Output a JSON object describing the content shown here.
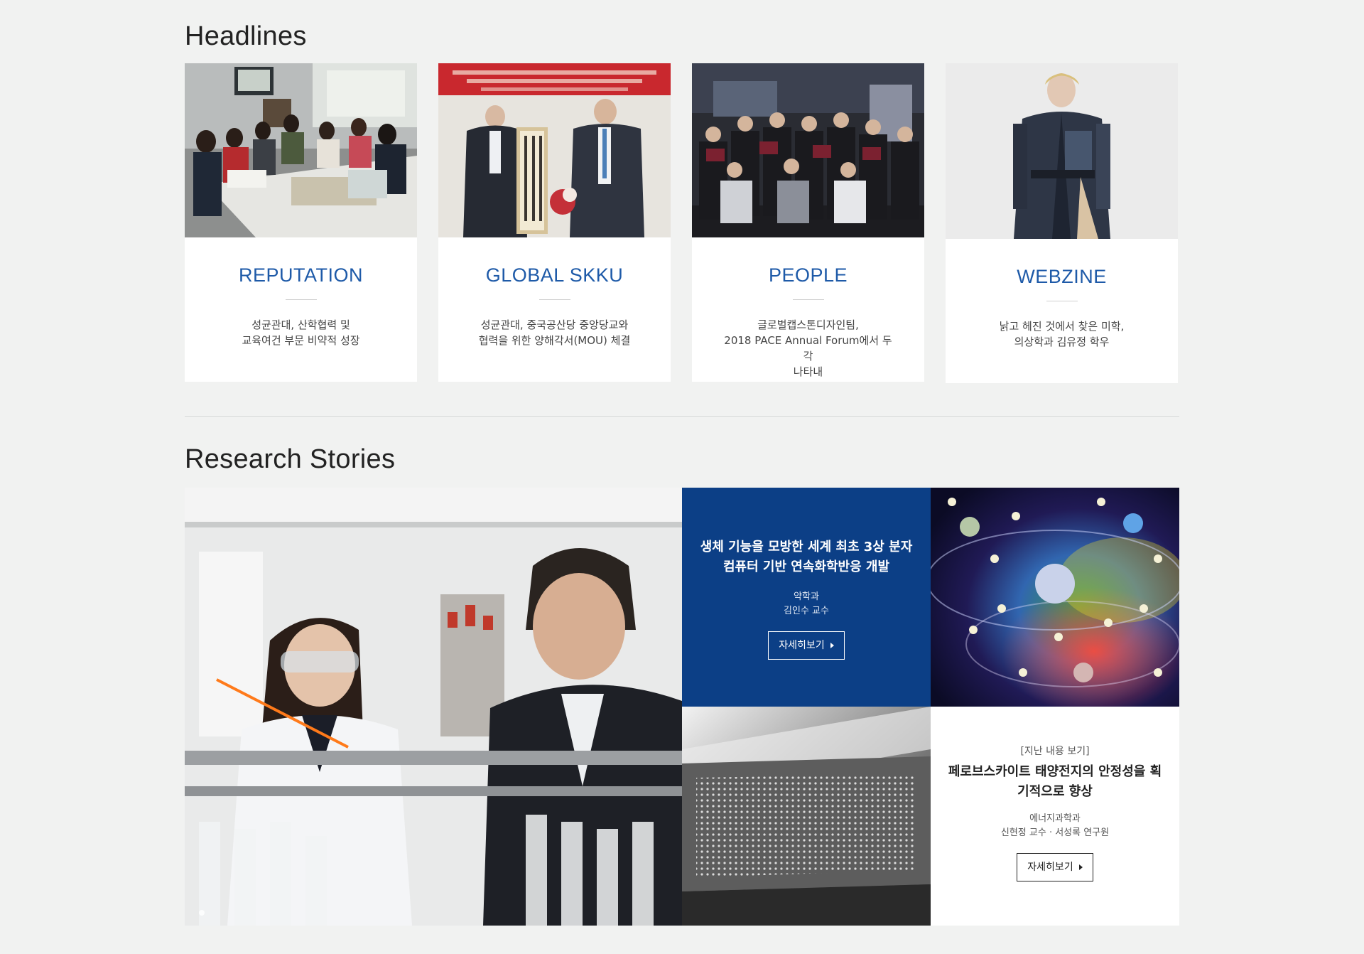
{
  "headlines": {
    "title": "Headlines",
    "cards": [
      {
        "title": "REPUTATION",
        "desc": "성균관대, 산학협력 및\n교육여건 부문 비약적 성장"
      },
      {
        "title": "GLOBAL SKKU",
        "desc": "성균관대, 중국공산당 중앙당교와\n협력을 위한 양해각서(MOU) 체결"
      },
      {
        "title": "PEOPLE",
        "desc": "글로벌캡스톤디자인팀,\n2018 PACE Annual Forum에서 두각\n나타내"
      },
      {
        "title": "WEBZINE",
        "desc": "낡고 헤진 것에서 찾은 미학,\n의상학과 김유정 학우"
      }
    ]
  },
  "research": {
    "title": "Research Stories",
    "feature": {
      "title": "생체 기능을 모방한 세계 최초 3상 분자\n컴퓨터 기반 연속화학반응 개발",
      "dept": "약학과",
      "prof": "김인수 교수",
      "more": "자세히보기"
    },
    "past": {
      "label": "[지난 내용 보기]",
      "title": "페로브스카이트 태양전지의 안정성을 획\n기적으로 향상",
      "dept": "에너지과학과",
      "prof": "신현정 교수 · 서성록 연구원",
      "more": "자세히보기"
    }
  },
  "colors": {
    "accent": "#1e5aa8",
    "feature_bg": "#0c3f86",
    "page_bg": "#f1f2f1"
  }
}
